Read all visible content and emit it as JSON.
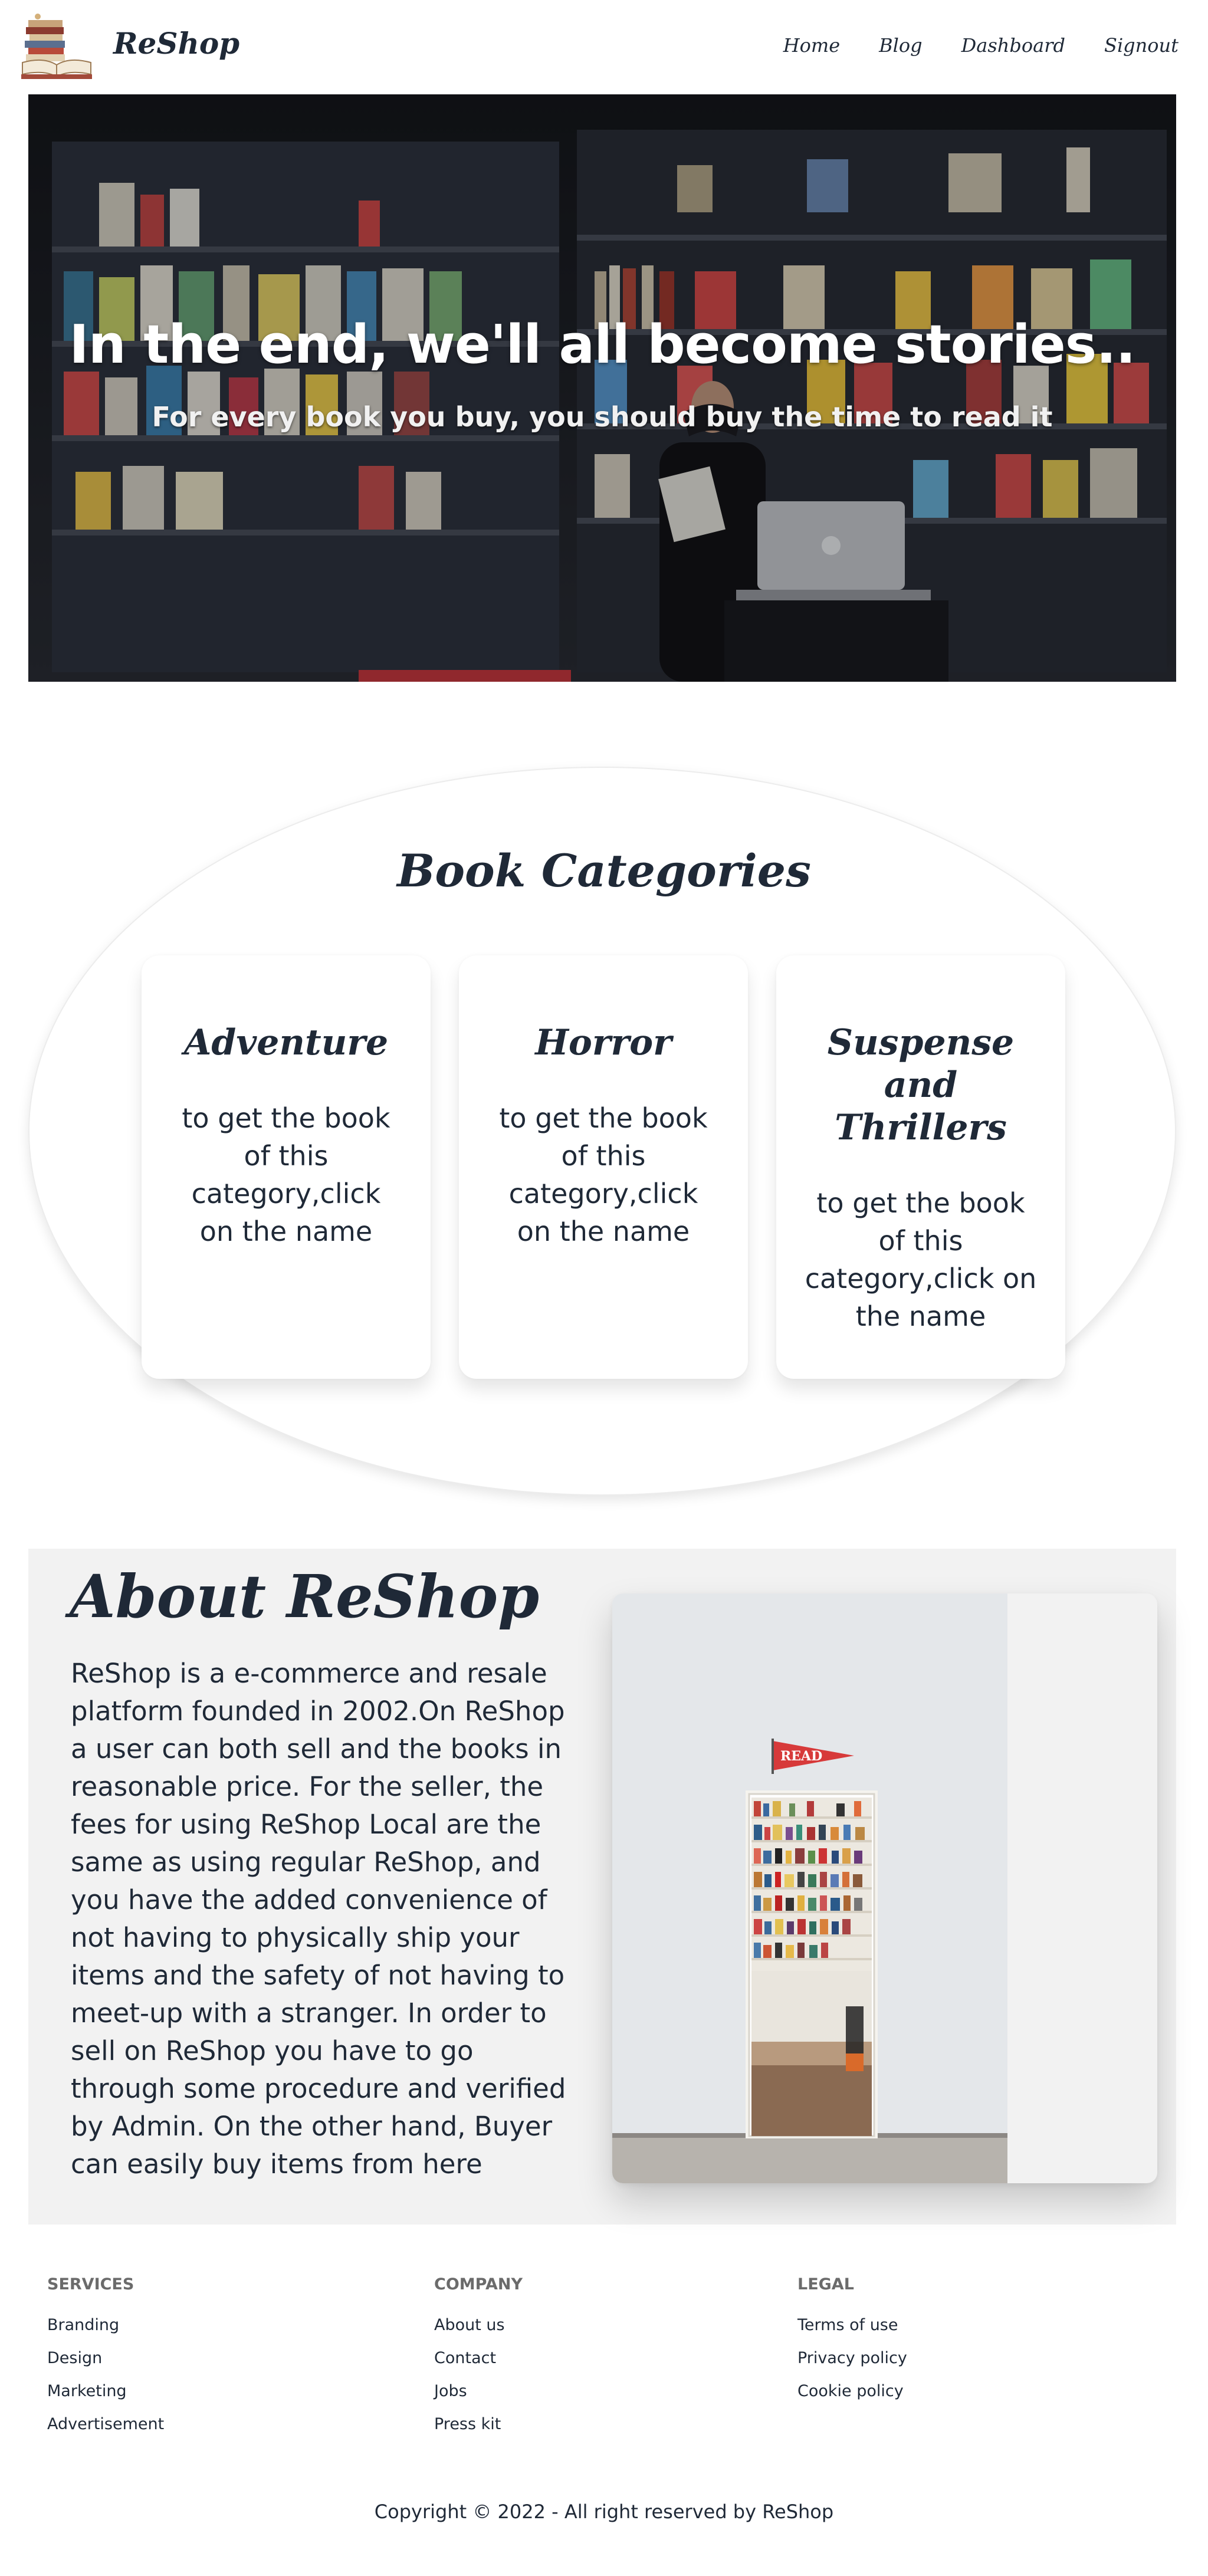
{
  "nav": {
    "brand": "ReShop",
    "links": [
      "Home",
      "Blog",
      "Dashboard",
      "Signout"
    ]
  },
  "hero": {
    "title": "In the end, we'll all become stories..",
    "subtitle": "For every book you buy, you should buy the time to read it"
  },
  "categories": {
    "title": "Book Categories",
    "items": [
      {
        "name": "Adventure",
        "desc": "to get the book of this category,click on the name"
      },
      {
        "name": "Horror",
        "desc": "to get the book of this category,click on the name"
      },
      {
        "name": "Suspense and Thrillers",
        "desc": "to get the book of this category,click on the name"
      }
    ]
  },
  "about": {
    "title": "About ReShop",
    "text": "ReShop is a e-commerce and resale platform founded in 2002.On ReShop a user can both sell and the books in reasonable price. For the seller, the fees for using ReShop Local are the same as using regular ReShop, and you have the added convenience of not having to physically ship your items and the safety of not having to meet-up with a stranger. In order to sell on ReShop you have to go through some procedure and verified by Admin. On the other hand, Buyer can easily buy items from here",
    "image_sign": "READ"
  },
  "footer": {
    "services": {
      "heading": "SERVICES",
      "links": [
        "Branding",
        "Design",
        "Marketing",
        "Advertisement"
      ]
    },
    "company": {
      "heading": "COMPANY",
      "links": [
        "About us",
        "Contact",
        "Jobs",
        "Press kit"
      ]
    },
    "legal": {
      "heading": "LEGAL",
      "links": [
        "Terms of use",
        "Privacy policy",
        "Cookie policy"
      ]
    },
    "copyright": "Copyright © 2022 - All right reserved by ReShop"
  }
}
